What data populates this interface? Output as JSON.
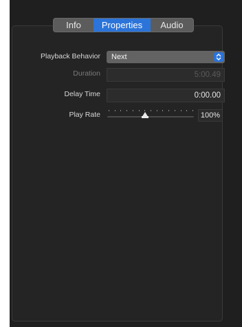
{
  "tabs": [
    {
      "label": "Info",
      "selected": false
    },
    {
      "label": "Properties",
      "selected": true
    },
    {
      "label": "Audio",
      "selected": false
    }
  ],
  "playback_behavior": {
    "label": "Playback Behavior",
    "value": "Next"
  },
  "duration": {
    "label": "Duration",
    "value": "5:00.49",
    "enabled": false
  },
  "delay_time": {
    "label": "Delay Time",
    "value": "0:00.00"
  },
  "play_rate": {
    "label": "Play Rate",
    "value_text": "100%",
    "slider_fraction": 0.44
  },
  "colors": {
    "accent": "#2b74d9",
    "background": "#1f1f1f",
    "panel": "#242424"
  }
}
